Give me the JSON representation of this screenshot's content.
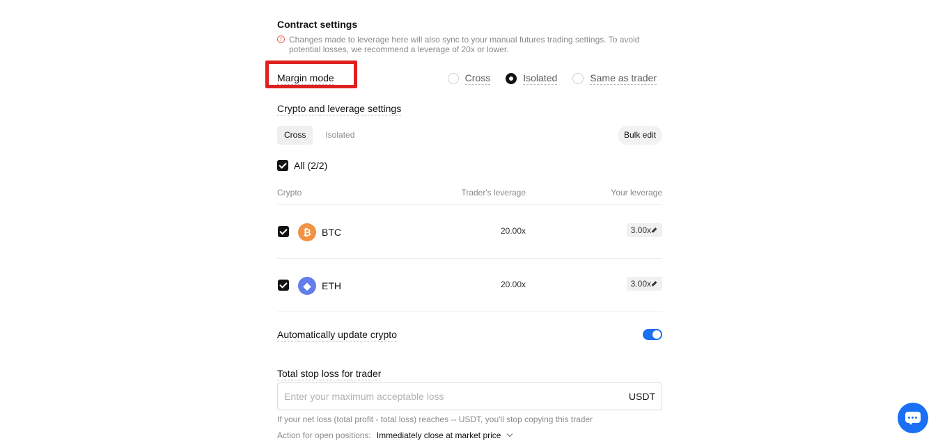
{
  "contract": {
    "title": "Contract settings",
    "warning": "Changes made to leverage here will also sync to your manual futures trading settings. To avoid potential losses, we recommend a leverage of 20x or lower.",
    "warning_icon": "info-circle-icon"
  },
  "margin_mode": {
    "label": "Margin mode",
    "options": [
      {
        "label": "Cross",
        "selected": false
      },
      {
        "label": "Isolated",
        "selected": true
      },
      {
        "label": "Same as trader",
        "selected": false
      }
    ]
  },
  "crypto_settings": {
    "label": "Crypto and leverage settings",
    "tabs": [
      {
        "label": "Cross",
        "active": true
      },
      {
        "label": "Isolated",
        "active": false
      }
    ],
    "bulk_edit": "Bulk edit",
    "all_label": "All (2/2)",
    "columns": [
      "Crypto",
      "Trader's leverage",
      "Your leverage"
    ],
    "rows": [
      {
        "symbol": "BTC",
        "icon": "bitcoin-icon",
        "trader_leverage": "20.00x",
        "your_leverage": "3.00x",
        "checked": true
      },
      {
        "symbol": "ETH",
        "icon": "ethereum-icon",
        "trader_leverage": "20.00x",
        "your_leverage": "3.00x",
        "checked": true
      }
    ]
  },
  "auto_update": {
    "label": "Automatically update crypto",
    "enabled": true
  },
  "stop_loss": {
    "label": "Total stop loss for trader",
    "placeholder": "Enter your maximum acceptable loss",
    "unit": "USDT",
    "hint": "If your net loss (total profit - total loss) reaches -- USDT, you'll stop copying this trader",
    "action_label": "Action for open positions:",
    "action_value": "Immediately close at market price"
  },
  "colors": {
    "accent": "#1b6ff5",
    "highlight": "#e02020",
    "btc": "#f09242",
    "eth": "#627eea"
  }
}
